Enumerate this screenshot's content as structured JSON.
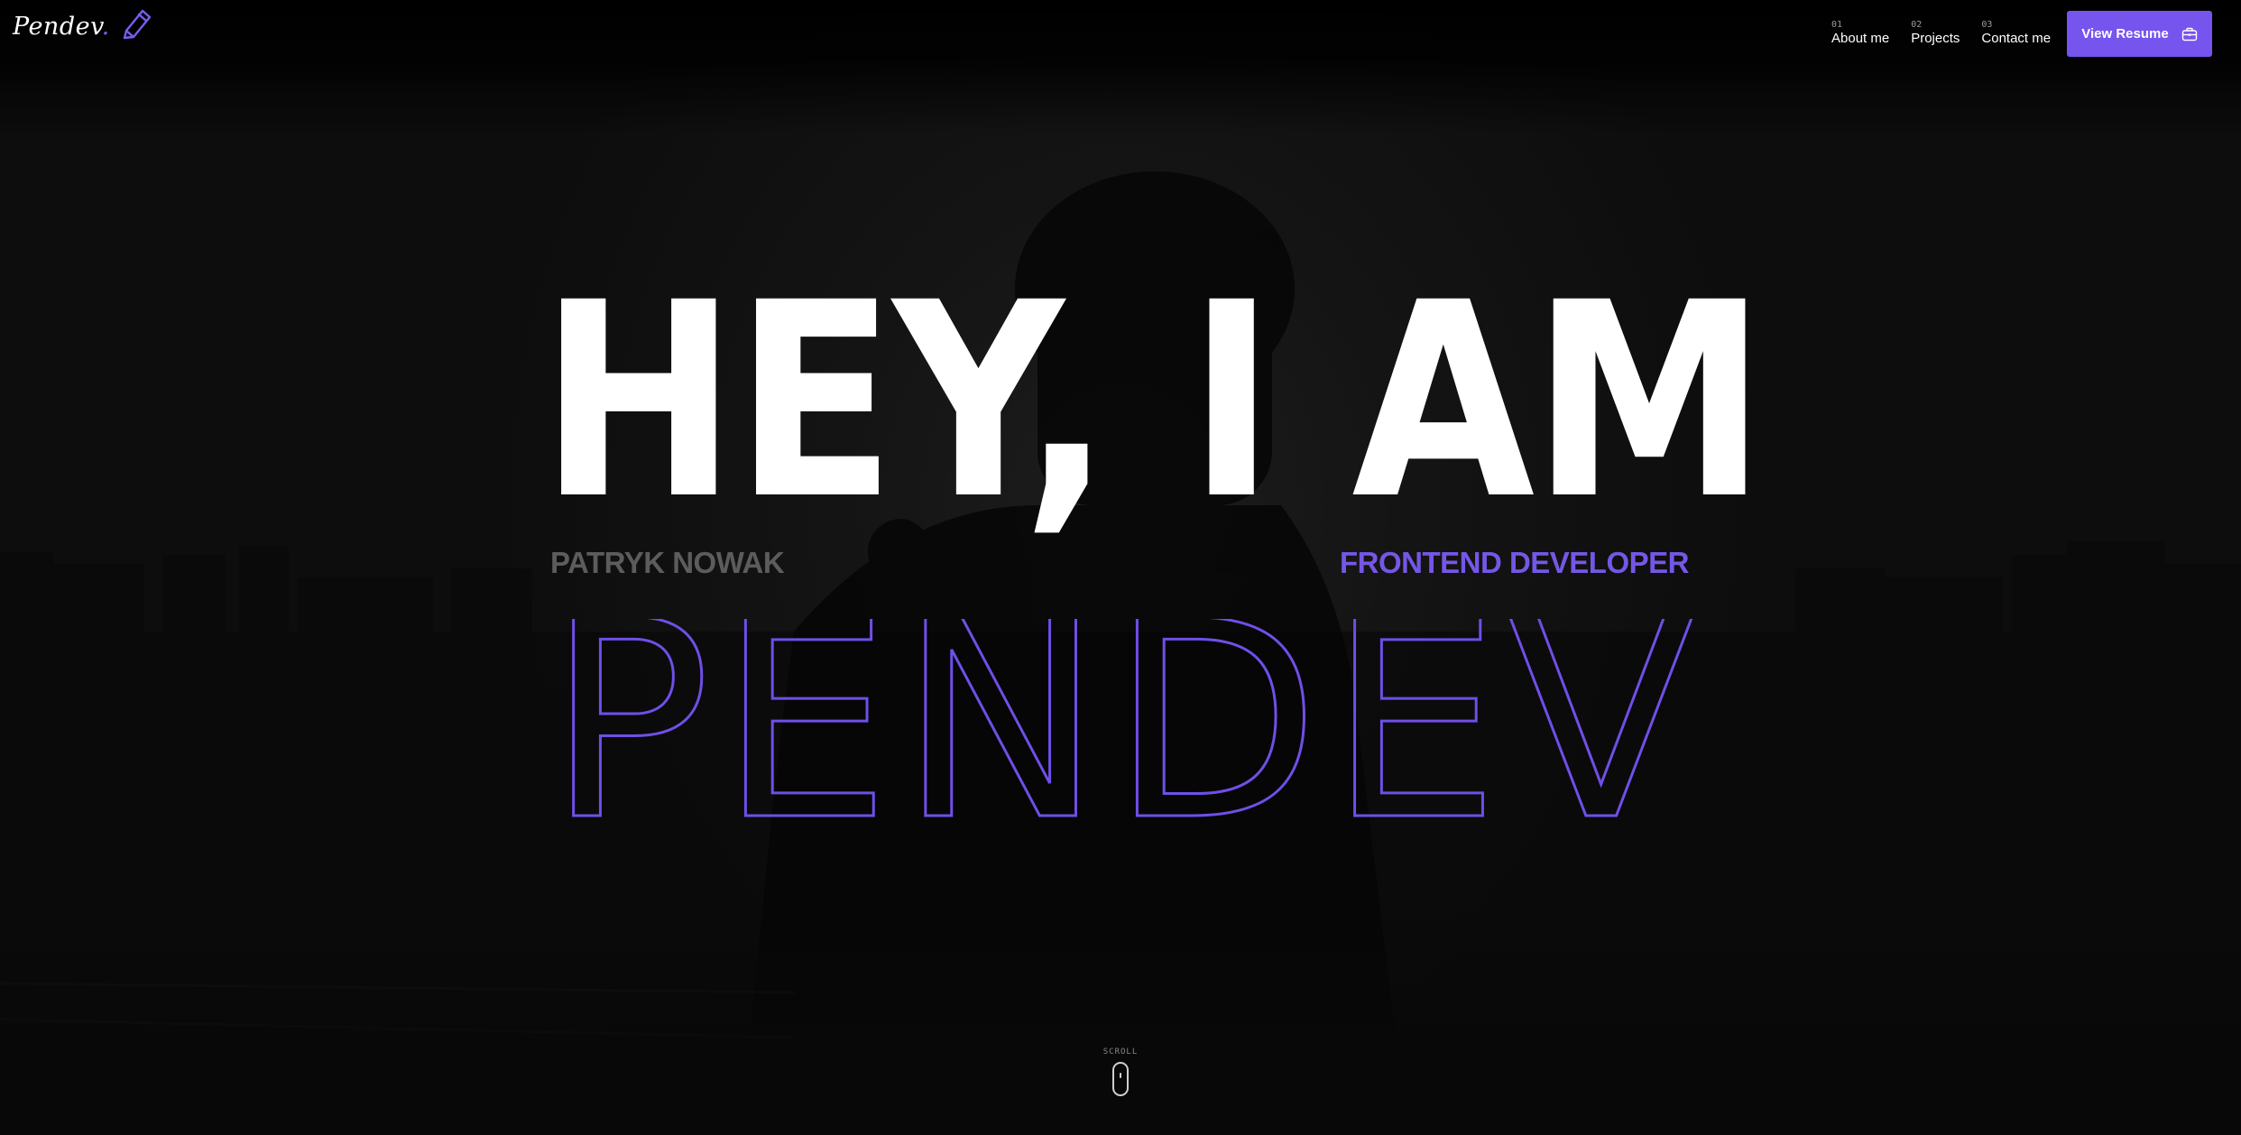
{
  "header": {
    "logo_text": "Pendev",
    "logo_dot": ".",
    "nav": [
      {
        "num": "01",
        "label": "About me"
      },
      {
        "num": "02",
        "label": "Projects"
      },
      {
        "num": "03",
        "label": "Contact me"
      }
    ],
    "resume_label": "View Resume"
  },
  "hero": {
    "title": "HEY, I AM",
    "name": "PATRYK NOWAK",
    "role": "FRONTEND DEVELOPER",
    "outline_word": "PENDEV"
  },
  "scroll": {
    "label": "SCROLL"
  },
  "colors": {
    "accent": "#7654ee",
    "outline": "#6f4fe8",
    "background": "#0b0b0b",
    "title": "#ffffff",
    "muted": "#5c5c5c"
  },
  "icons": {
    "logo": "pencil-icon",
    "resume": "briefcase-icon",
    "scroll": "mouse-icon"
  }
}
